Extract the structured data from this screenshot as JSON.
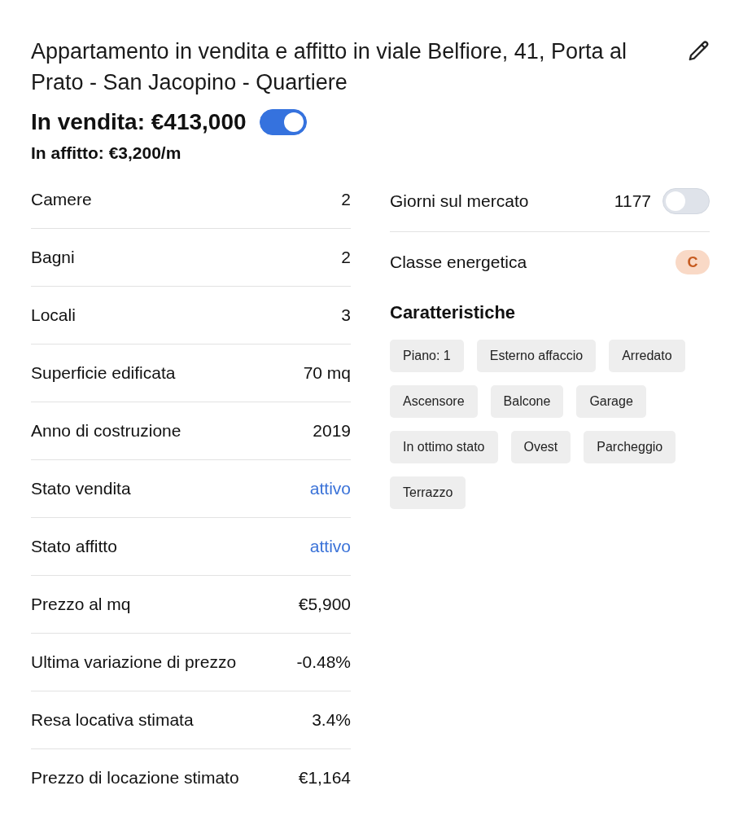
{
  "title": "Appartamento in vendita e affitto in viale Belfiore, 41, Porta al Prato - San Jacopino - Quartiere",
  "sale": {
    "label": "In vendita: €413,000",
    "on": true
  },
  "rent": {
    "label": "In affitto: €3,200/m"
  },
  "details": [
    {
      "label": "Camere",
      "value": "2",
      "kind": "text"
    },
    {
      "label": "Bagni",
      "value": "2",
      "kind": "text"
    },
    {
      "label": "Locali",
      "value": "3",
      "kind": "text"
    },
    {
      "label": "Superficie edificata",
      "value": "70 mq",
      "kind": "text"
    },
    {
      "label": "Anno di costruzione",
      "value": "2019",
      "kind": "text"
    },
    {
      "label": "Stato vendita",
      "value": "attivo",
      "kind": "link"
    },
    {
      "label": "Stato affitto",
      "value": "attivo",
      "kind": "link"
    },
    {
      "label": "Prezzo al mq",
      "value": "€5,900",
      "kind": "text"
    },
    {
      "label": "Ultima variazione di prezzo",
      "value": "-0.48%",
      "kind": "text"
    },
    {
      "label": "Resa locativa stimata",
      "value": "3.4%",
      "kind": "text"
    },
    {
      "label": "Prezzo di locazione stimato",
      "value": "€1,164",
      "kind": "text"
    }
  ],
  "market_days": {
    "label": "Giorni sul mercato",
    "value": "1177",
    "on": false
  },
  "energy_class": {
    "label": "Classe energetica",
    "value": "C",
    "color": "#f9d9c6"
  },
  "features": {
    "title": "Caratteristiche",
    "tags": [
      "Piano: 1",
      "Esterno affaccio",
      "Arredato",
      "Ascensore",
      "Balcone",
      "Garage",
      "In ottimo stato",
      "Ovest",
      "Parcheggio",
      "Terrazzo"
    ]
  }
}
